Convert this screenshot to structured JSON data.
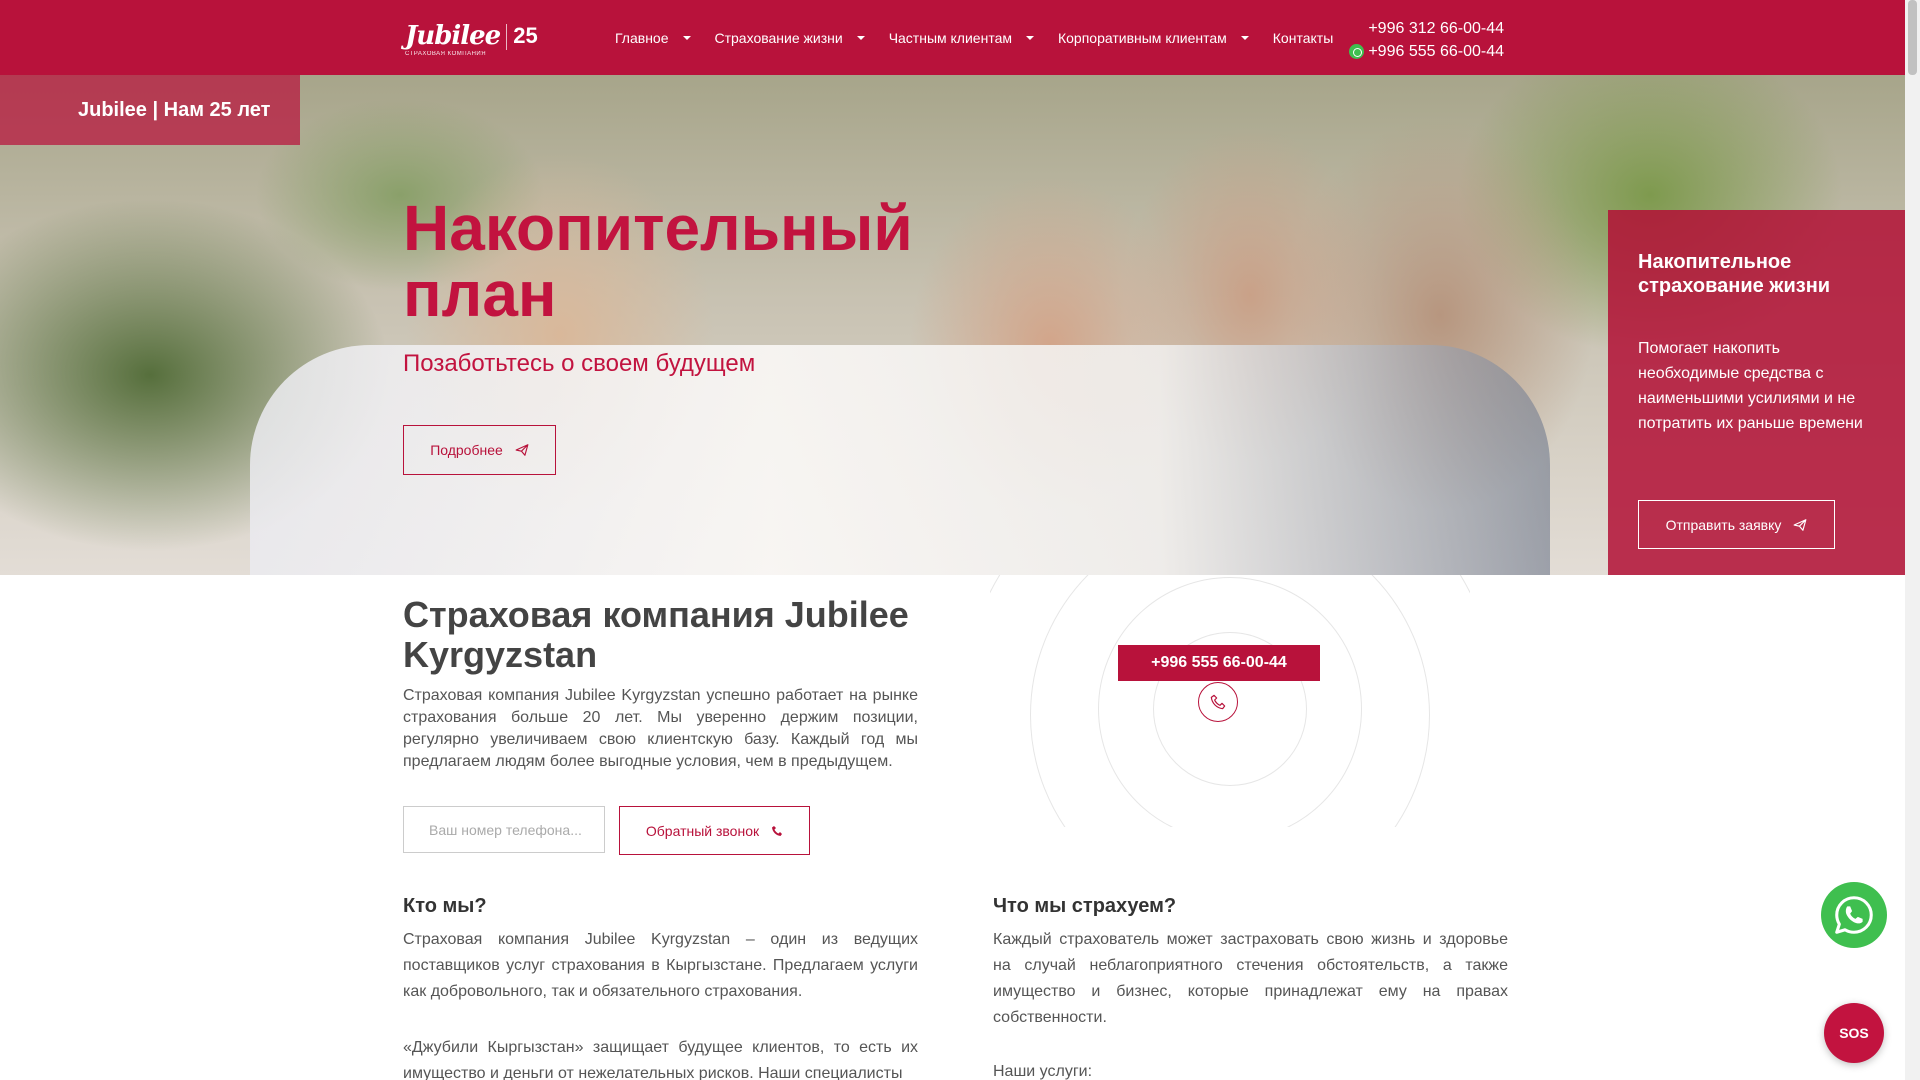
{
  "header": {
    "logo_word": "Jubilee",
    "logo_sub": "СТРАХОВАЯ КОМПАНИЯ",
    "logo_badge": "25",
    "nav": [
      {
        "label": "Главное",
        "has_dropdown": true
      },
      {
        "label": "Страхование жизни",
        "has_dropdown": true
      },
      {
        "label": "Частным клиентам",
        "has_dropdown": true
      },
      {
        "label": "Корпоративным клиентам",
        "has_dropdown": true
      },
      {
        "label": "Контакты",
        "has_dropdown": false
      }
    ],
    "phone_1": "+996 312 66-00-44",
    "phone_2": "+996 555 66-00-44"
  },
  "hero": {
    "badge": "Jubilee | Нам 25 лет",
    "title": "Накопительный план",
    "subtitle": "Позаботьтесь о своем будущем",
    "more_button": "Подробнее",
    "panel_title": "Накопительное страхование жизни",
    "panel_text": "Помогает накопить необходимые средства с наименьшими усилиями и не потратить их раньше времени",
    "panel_button": "Отправить заявку"
  },
  "company": {
    "title": "Страховая компания Jubilee Kyrgyzstan",
    "text": "Страховая компания Jubilee Kyrgyzstan успешно работает на рынке страхования больше 20 лет. Мы уверенно держим позиции, регулярно увеличиваем свою клиентскую базу. Каждый год мы предлагаем людям более выгодные условия, чем в предыдущем.",
    "phone_placeholder": "Ваш номер телефона...",
    "callback_button": "Обратный звонок",
    "call_number": "+996 555 66-00-44"
  },
  "who": {
    "title": "Кто мы?",
    "paragraph_1": "Страховая компания Jubilee Kyrgyzstan – один из ведущих поставщиков услуг страхования в Кыргызстане. Предлагаем услуги как добровольного, так и обязательного страхования.",
    "paragraph_2": "«Джубили Кыргызстан» защищает будущее клиентов, то есть их имущество и деньги от нежелательных рисков. Наши специалисты"
  },
  "what": {
    "title": "Что мы страхуем?",
    "paragraph_1": "Каждый страхователь может застраховать свою жизнь и здоровье на случай неблагоприятного стечения обстоятельств, а также имущество и бизнес, которые принадлежат ему на правах собственности.",
    "paragraph_2": "Наши услуги:"
  },
  "floating": {
    "sos": "SOS"
  },
  "colors": {
    "brand": "#b8123b",
    "whatsapp": "#3fbf4f"
  }
}
